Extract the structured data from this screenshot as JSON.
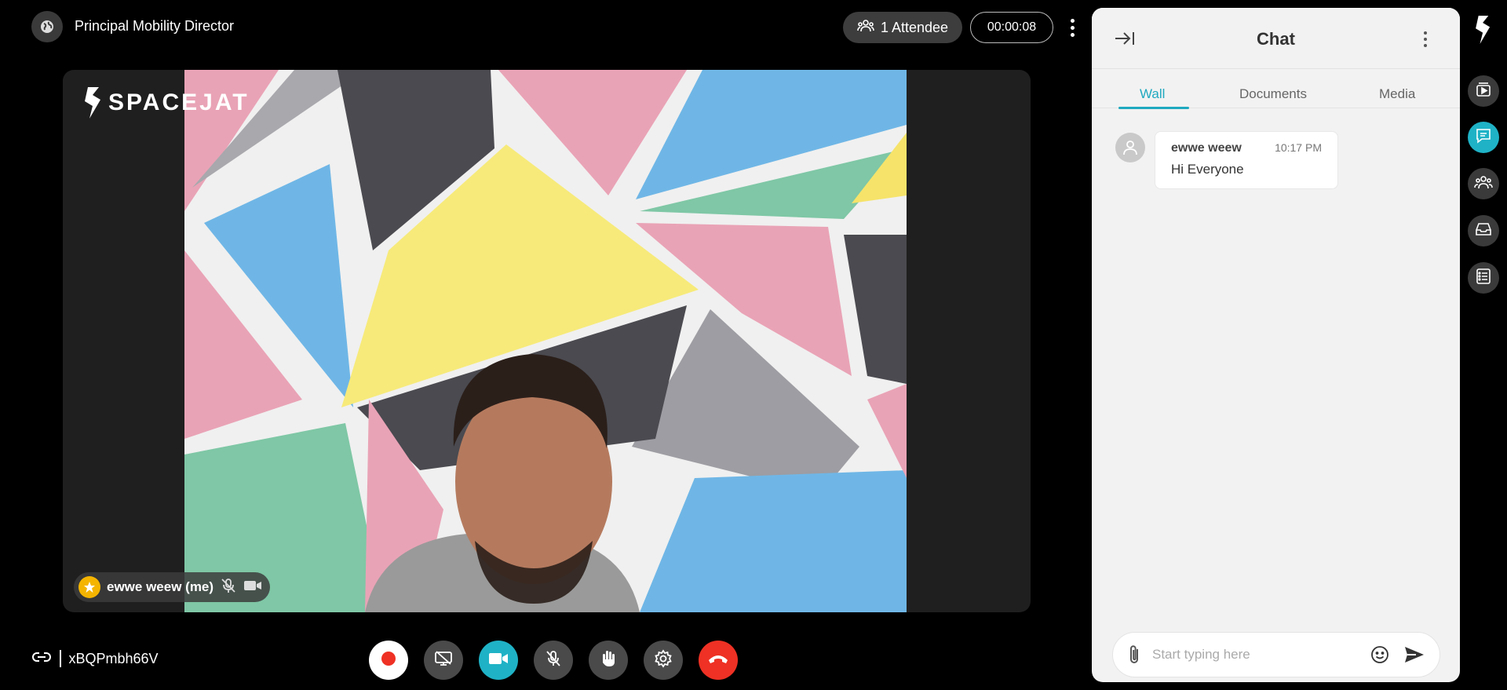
{
  "topbar": {
    "room_title": "Principal Mobility Director",
    "attendee_label": "1 Attendee",
    "timer": "00:00:08"
  },
  "stage": {
    "logo_text": "SPACEJAT",
    "participant_name": "ewwe weew (me)"
  },
  "bottombar": {
    "room_code": "xBQPmbh66V"
  },
  "chat": {
    "title": "Chat",
    "tabs": [
      {
        "label": "Wall",
        "active": true
      },
      {
        "label": "Documents",
        "active": false
      },
      {
        "label": "Media",
        "active": false
      }
    ],
    "messages": [
      {
        "author": "ewwe weew",
        "time": "10:17 PM",
        "text": "Hi Everyone"
      }
    ],
    "input_placeholder": "Start typing here"
  },
  "colors": {
    "accent": "#1fb2c6",
    "end_call": "#ee3124",
    "record": "#ee3124"
  },
  "icons": {
    "controls": [
      "record-icon",
      "screen-share-off-icon",
      "video-camera-icon",
      "microphone-off-icon",
      "raise-hand-icon",
      "settings-icon",
      "end-call-icon"
    ],
    "rail": [
      "spacejat-logo-icon",
      "playlist-icon",
      "chat-icon",
      "people-icon",
      "inbox-icon",
      "list-icon"
    ]
  }
}
